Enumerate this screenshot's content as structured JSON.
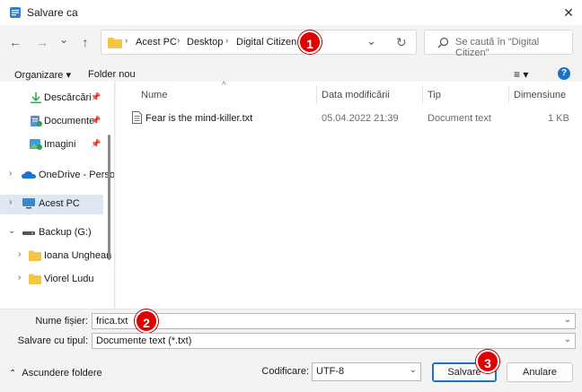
{
  "window": {
    "title": "Salvare ca",
    "close_icon": "✕"
  },
  "nav": {
    "back_icon": "←",
    "forward_icon": "→",
    "recent_icon": "⌄",
    "up_icon": "↑",
    "breadcrumb": [
      "Acest PC",
      "Desktop",
      "Digital Citizen"
    ],
    "sep": "›",
    "dropdown_icon": "⌄",
    "refresh_icon": "↻",
    "search_placeholder": "Se caută în \"Digital Citizen\""
  },
  "badges": {
    "one": "1",
    "two": "2",
    "three": "3"
  },
  "commands": {
    "organize": "Organizare ▾",
    "new_folder": "Folder nou",
    "view_icon": "≡ ▾",
    "help_icon": "?"
  },
  "sidebar": {
    "items": [
      {
        "label": "Descărcări"
      },
      {
        "label": "Documente"
      },
      {
        "label": "Imagini"
      },
      {
        "label": "OneDrive - Perso"
      },
      {
        "label": "Acest PC"
      },
      {
        "label": "Backup (G:)"
      },
      {
        "label": "Ioana Unghean"
      },
      {
        "label": "Viorel Ludu"
      }
    ],
    "pin": "📌"
  },
  "list": {
    "columns": [
      "Nume",
      "Data modificării",
      "Tip",
      "Dimensiune"
    ],
    "sort_icon": "^",
    "rows": [
      {
        "name": "Fear is the mind-killer.txt",
        "date": "05.04.2022 21:39",
        "type": "Document text",
        "size": "1 KB"
      }
    ]
  },
  "form": {
    "filename_label": "Nume fișier:",
    "filename_value": "frica.txt",
    "type_label": "Salvare cu tipul:",
    "type_value": "Documente text (*.txt)",
    "hide_folders": "Ascundere foldere",
    "encoding_label": "Codificare:",
    "encoding_value": "UTF-8",
    "save": "Salvare",
    "cancel": "Anulare"
  },
  "colors": {
    "accent": "#1a73c8",
    "badge": "#e00000",
    "folder": "#f4c542"
  }
}
